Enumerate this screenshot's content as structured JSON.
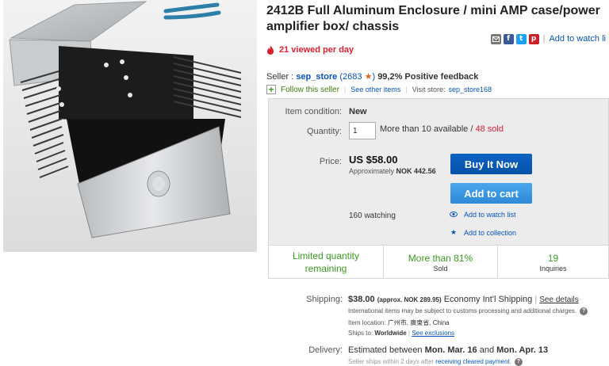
{
  "listing": {
    "title": "2412B Full Aluminum Enclosure / mini AMP case/power amplifier box/ chassis",
    "viewed": "21 viewed per day",
    "watch_link": "Add to watch li"
  },
  "share": {
    "icons": [
      "envelope-icon",
      "facebook-icon",
      "twitter-icon",
      "pinterest-icon"
    ],
    "facebook": "f",
    "twitter": "t",
    "pinterest": "p"
  },
  "seller": {
    "prefix": "Seller :",
    "name": "sep_store",
    "score": "2683",
    "feedback": "99,2% Positive feedback",
    "follow": "Follow this seller",
    "see_other": "See other items",
    "visit_label": "Visit store:",
    "store": "sep_store168"
  },
  "purchase": {
    "condition_label": "Item condition:",
    "condition": "New",
    "quantity_label": "Quantity:",
    "quantity_value": "1",
    "available": "More than 10 available /",
    "sold": "48 sold",
    "price_label": "Price:",
    "price": "US $58.00",
    "approx_prefix": "Approximately",
    "approx_value": "NOK 442.56",
    "buy_now": "Buy It Now",
    "add_to_cart": "Add to cart",
    "watching": "160 watching",
    "add_watch": "Add to watch list",
    "add_collection": "Add to collection"
  },
  "stats": {
    "limited_line1": "Limited quantity",
    "limited_line2": "remaining",
    "sold_pct": "More than 81%",
    "sold_label": "Sold",
    "inquiries": "19",
    "inquiries_label": "Inquiries"
  },
  "shipping": {
    "label": "Shipping:",
    "cost": "$38.00",
    "approx": "(approx. NOK 289.95)",
    "service": "Economy Int'l Shipping",
    "details": "See details",
    "note": "International items may be subject to customs processing and additional charges.",
    "location_label": "Item location:",
    "location": "广州市, 廣東省, China",
    "ships_to_label": "Ships to:",
    "ships_to": "Worldwide",
    "exclusions": "See exclusions"
  },
  "delivery": {
    "label": "Delivery:",
    "prefix": "Estimated between",
    "start": "Mon. Mar. 16",
    "and": "and",
    "end": "Mon. Apr. 13",
    "note_prefix": "Seller ships within 2 days after",
    "note_link": "receiving cleared payment",
    "note_suffix": "."
  },
  "colors": {
    "link_blue": "#0654ba",
    "buy_now": "#0551a8",
    "add_cart": "#2f8ad8",
    "alert_red": "#dd1e31",
    "success_green": "#3a9b1f"
  }
}
